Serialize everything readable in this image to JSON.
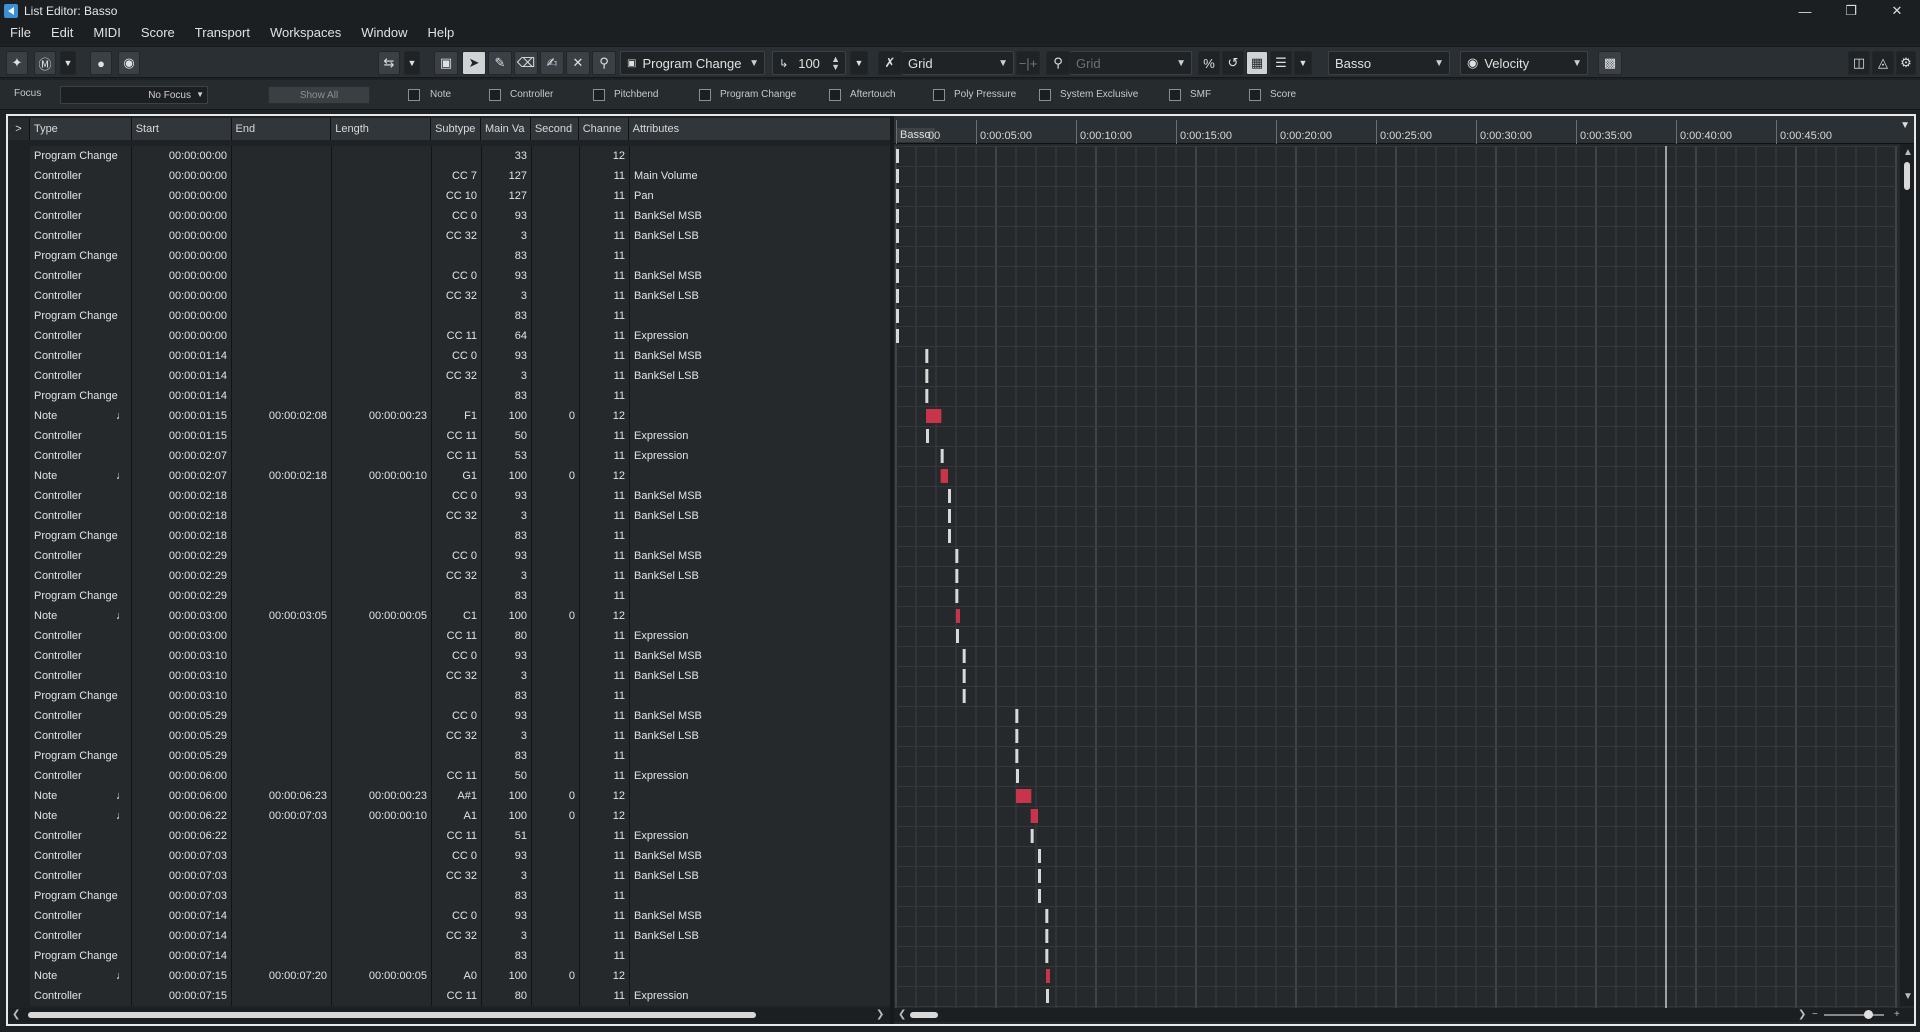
{
  "window": {
    "title": "List Editor: Basso"
  },
  "menu": [
    "File",
    "Edit",
    "MIDI",
    "Score",
    "Transport",
    "Workspaces",
    "Window",
    "Help"
  ],
  "toolbar": {
    "insert_type": "Program Change",
    "insert_value": "100",
    "snap_type": "Grid",
    "quantize": "Grid",
    "track": "Basso",
    "value_lane": "Velocity"
  },
  "filterbar": {
    "focus_label": "Focus",
    "focus_value": "No Focus",
    "show_all": "Show All",
    "filters": [
      "Note",
      "Controller",
      "Pitchbend",
      "Program Change",
      "Aftertouch",
      "Poly Pressure",
      "System Exclusive",
      "SMF",
      "Score"
    ]
  },
  "list": {
    "expand": ">",
    "columns": [
      "Type",
      "Start",
      "End",
      "Length",
      "Subtype",
      "Main Va",
      "Second",
      "Channe",
      "Attributes"
    ],
    "rows": [
      [
        "Program Change",
        "00:00:00:00",
        "",
        "",
        "",
        "33",
        "",
        "12",
        ""
      ],
      [
        "Controller",
        "00:00:00:00",
        "",
        "",
        "CC 7",
        "127",
        "",
        "11",
        "Main Volume"
      ],
      [
        "Controller",
        "00:00:00:00",
        "",
        "",
        "CC 10",
        "127",
        "",
        "11",
        "Pan"
      ],
      [
        "Controller",
        "00:00:00:00",
        "",
        "",
        "CC 0",
        "93",
        "",
        "11",
        "BankSel MSB"
      ],
      [
        "Controller",
        "00:00:00:00",
        "",
        "",
        "CC 32",
        "3",
        "",
        "11",
        "BankSel LSB"
      ],
      [
        "Program Change",
        "00:00:00:00",
        "",
        "",
        "",
        "83",
        "",
        "11",
        ""
      ],
      [
        "Controller",
        "00:00:00:00",
        "",
        "",
        "CC 0",
        "93",
        "",
        "11",
        "BankSel MSB"
      ],
      [
        "Controller",
        "00:00:00:00",
        "",
        "",
        "CC 32",
        "3",
        "",
        "11",
        "BankSel LSB"
      ],
      [
        "Program Change",
        "00:00:00:00",
        "",
        "",
        "",
        "83",
        "",
        "11",
        ""
      ],
      [
        "Controller",
        "00:00:00:00",
        "",
        "",
        "CC 11",
        "64",
        "",
        "11",
        "Expression"
      ],
      [
        "Controller",
        "00:00:01:14",
        "",
        "",
        "CC 0",
        "93",
        "",
        "11",
        "BankSel MSB"
      ],
      [
        "Controller",
        "00:00:01:14",
        "",
        "",
        "CC 32",
        "3",
        "",
        "11",
        "BankSel LSB"
      ],
      [
        "Program Change",
        "00:00:01:14",
        "",
        "",
        "",
        "83",
        "",
        "11",
        ""
      ],
      [
        "Note",
        "00:00:01:15",
        "00:00:02:08",
        "00:00:00:23",
        "F1",
        "100",
        "0",
        "12",
        ""
      ],
      [
        "Controller",
        "00:00:01:15",
        "",
        "",
        "CC 11",
        "50",
        "",
        "11",
        "Expression"
      ],
      [
        "Controller",
        "00:00:02:07",
        "",
        "",
        "CC 11",
        "53",
        "",
        "11",
        "Expression"
      ],
      [
        "Note",
        "00:00:02:07",
        "00:00:02:18",
        "00:00:00:10",
        "G1",
        "100",
        "0",
        "12",
        ""
      ],
      [
        "Controller",
        "00:00:02:18",
        "",
        "",
        "CC 0",
        "93",
        "",
        "11",
        "BankSel MSB"
      ],
      [
        "Controller",
        "00:00:02:18",
        "",
        "",
        "CC 32",
        "3",
        "",
        "11",
        "BankSel LSB"
      ],
      [
        "Program Change",
        "00:00:02:18",
        "",
        "",
        "",
        "83",
        "",
        "11",
        ""
      ],
      [
        "Controller",
        "00:00:02:29",
        "",
        "",
        "CC 0",
        "93",
        "",
        "11",
        "BankSel MSB"
      ],
      [
        "Controller",
        "00:00:02:29",
        "",
        "",
        "CC 32",
        "3",
        "",
        "11",
        "BankSel LSB"
      ],
      [
        "Program Change",
        "00:00:02:29",
        "",
        "",
        "",
        "83",
        "",
        "11",
        ""
      ],
      [
        "Note",
        "00:00:03:00",
        "00:00:03:05",
        "00:00:00:05",
        "C1",
        "100",
        "0",
        "12",
        ""
      ],
      [
        "Controller",
        "00:00:03:00",
        "",
        "",
        "CC 11",
        "80",
        "",
        "11",
        "Expression"
      ],
      [
        "Controller",
        "00:00:03:10",
        "",
        "",
        "CC 0",
        "93",
        "",
        "11",
        "BankSel MSB"
      ],
      [
        "Controller",
        "00:00:03:10",
        "",
        "",
        "CC 32",
        "3",
        "",
        "11",
        "BankSel LSB"
      ],
      [
        "Program Change",
        "00:00:03:10",
        "",
        "",
        "",
        "83",
        "",
        "11",
        ""
      ],
      [
        "Controller",
        "00:00:05:29",
        "",
        "",
        "CC 0",
        "93",
        "",
        "11",
        "BankSel MSB"
      ],
      [
        "Controller",
        "00:00:05:29",
        "",
        "",
        "CC 32",
        "3",
        "",
        "11",
        "BankSel LSB"
      ],
      [
        "Program Change",
        "00:00:05:29",
        "",
        "",
        "",
        "83",
        "",
        "11",
        ""
      ],
      [
        "Controller",
        "00:00:06:00",
        "",
        "",
        "CC 11",
        "50",
        "",
        "11",
        "Expression"
      ],
      [
        "Note",
        "00:00:06:00",
        "00:00:06:23",
        "00:00:00:23",
        "A#1",
        "100",
        "0",
        "12",
        ""
      ],
      [
        "Note",
        "00:00:06:22",
        "00:00:07:03",
        "00:00:00:10",
        "A1",
        "100",
        "0",
        "12",
        ""
      ],
      [
        "Controller",
        "00:00:06:22",
        "",
        "",
        "CC 11",
        "51",
        "",
        "11",
        "Expression"
      ],
      [
        "Controller",
        "00:00:07:03",
        "",
        "",
        "CC 0",
        "93",
        "",
        "11",
        "BankSel MSB"
      ],
      [
        "Controller",
        "00:00:07:03",
        "",
        "",
        "CC 32",
        "3",
        "",
        "11",
        "BankSel LSB"
      ],
      [
        "Program Change",
        "00:00:07:03",
        "",
        "",
        "",
        "83",
        "",
        "11",
        ""
      ],
      [
        "Controller",
        "00:00:07:14",
        "",
        "",
        "CC 0",
        "93",
        "",
        "11",
        "BankSel MSB"
      ],
      [
        "Controller",
        "00:00:07:14",
        "",
        "",
        "CC 32",
        "3",
        "",
        "11",
        "BankSel LSB"
      ],
      [
        "Program Change",
        "00:00:07:14",
        "",
        "",
        "",
        "83",
        "",
        "11",
        ""
      ],
      [
        "Note",
        "00:00:07:15",
        "00:00:07:20",
        "00:00:00:05",
        "A0",
        "100",
        "0",
        "12",
        ""
      ],
      [
        "Controller",
        "00:00:07:15",
        "",
        "",
        "CC 11",
        "80",
        "",
        "11",
        "Expression"
      ]
    ]
  },
  "graph": {
    "track_label": "Basso",
    "ruler_labels": [
      "00",
      "0:00:05:00",
      "0:00:10:00",
      "0:00:15:00",
      "0:00:20:00",
      "0:00:25:00",
      "0:00:30:00",
      "0:00:35:00",
      "0:00:40:00",
      "0:00:45:00"
    ],
    "event_color": "#d8d8d8",
    "note_color": "#c8354a"
  }
}
